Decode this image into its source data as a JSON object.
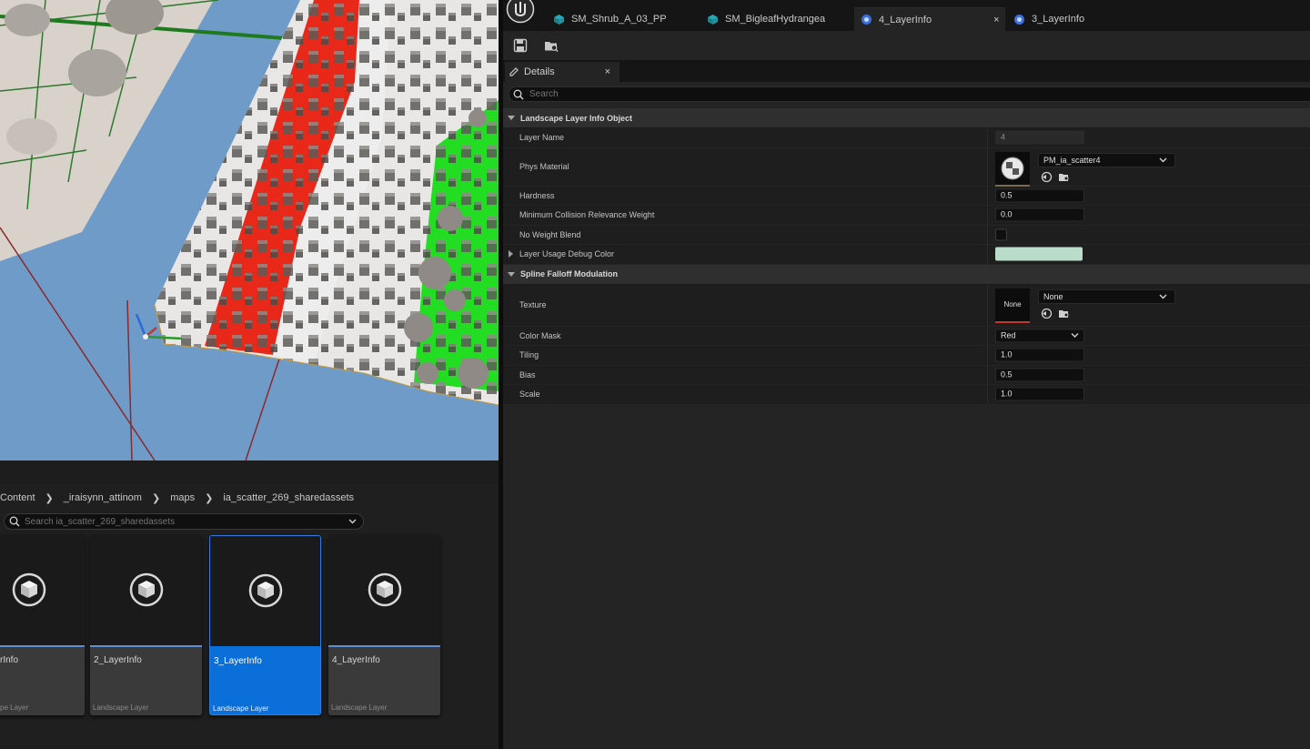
{
  "editor": {
    "tabs": [
      {
        "label": "SM_Shrub_A_03_PP",
        "icon": "static-mesh-icon"
      },
      {
        "label": "SM_BigleafHydrangea",
        "icon": "static-mesh-icon"
      },
      {
        "label": "4_LayerInfo",
        "icon": "layer-info-icon",
        "active": true,
        "close": "×"
      },
      {
        "label": "3_LayerInfo",
        "icon": "layer-info-icon"
      }
    ],
    "toolbar": {
      "save_icon": "save-icon",
      "browse_icon": "browse-to-asset-icon"
    },
    "details_tab": {
      "label": "Details",
      "close": "×"
    },
    "search_placeholder": "Search",
    "categories": {
      "landscape": "Landscape Layer Info Object",
      "spline": "Spline Falloff Modulation"
    },
    "properties": {
      "layer_name": {
        "label": "Layer Name",
        "value": "4"
      },
      "phys_material": {
        "label": "Phys Material",
        "value": "PM_ia_scatter4"
      },
      "hardness": {
        "label": "Hardness",
        "value": "0.5"
      },
      "min_collision": {
        "label": "Minimum Collision Relevance Weight",
        "value": "0.0"
      },
      "no_weight_blend": {
        "label": "No Weight Blend",
        "value": false
      },
      "debug_color": {
        "label": "Layer Usage Debug Color",
        "color": "#b9dccb"
      },
      "texture": {
        "label": "Texture",
        "value": "None",
        "thumb": "None"
      },
      "color_mask": {
        "label": "Color Mask",
        "value": "Red"
      },
      "tiling": {
        "label": "Tiling",
        "value": "1.0"
      },
      "bias": {
        "label": "Bias",
        "value": "0.5"
      },
      "scale": {
        "label": "Scale",
        "value": "1.0"
      }
    }
  },
  "content_browser": {
    "breadcrumb": [
      "Content",
      "_iraisynn_attinom",
      "maps",
      "ia_scatter_269_sharedassets"
    ],
    "search_placeholder": "Search ia_scatter_269_sharedassets",
    "assets": [
      {
        "name": "rInfo",
        "type": "pe Layer"
      },
      {
        "name": "2_LayerInfo",
        "type": "Landscape Layer"
      },
      {
        "name": "3_LayerInfo",
        "type": "Landscape Layer",
        "selected": true
      },
      {
        "name": "4_LayerInfo",
        "type": "Landscape Layer"
      }
    ]
  },
  "colors": {
    "selection": "#0a6fd9",
    "accent_bar": "#5b8ed2",
    "debug_color": "#b9dccb"
  }
}
